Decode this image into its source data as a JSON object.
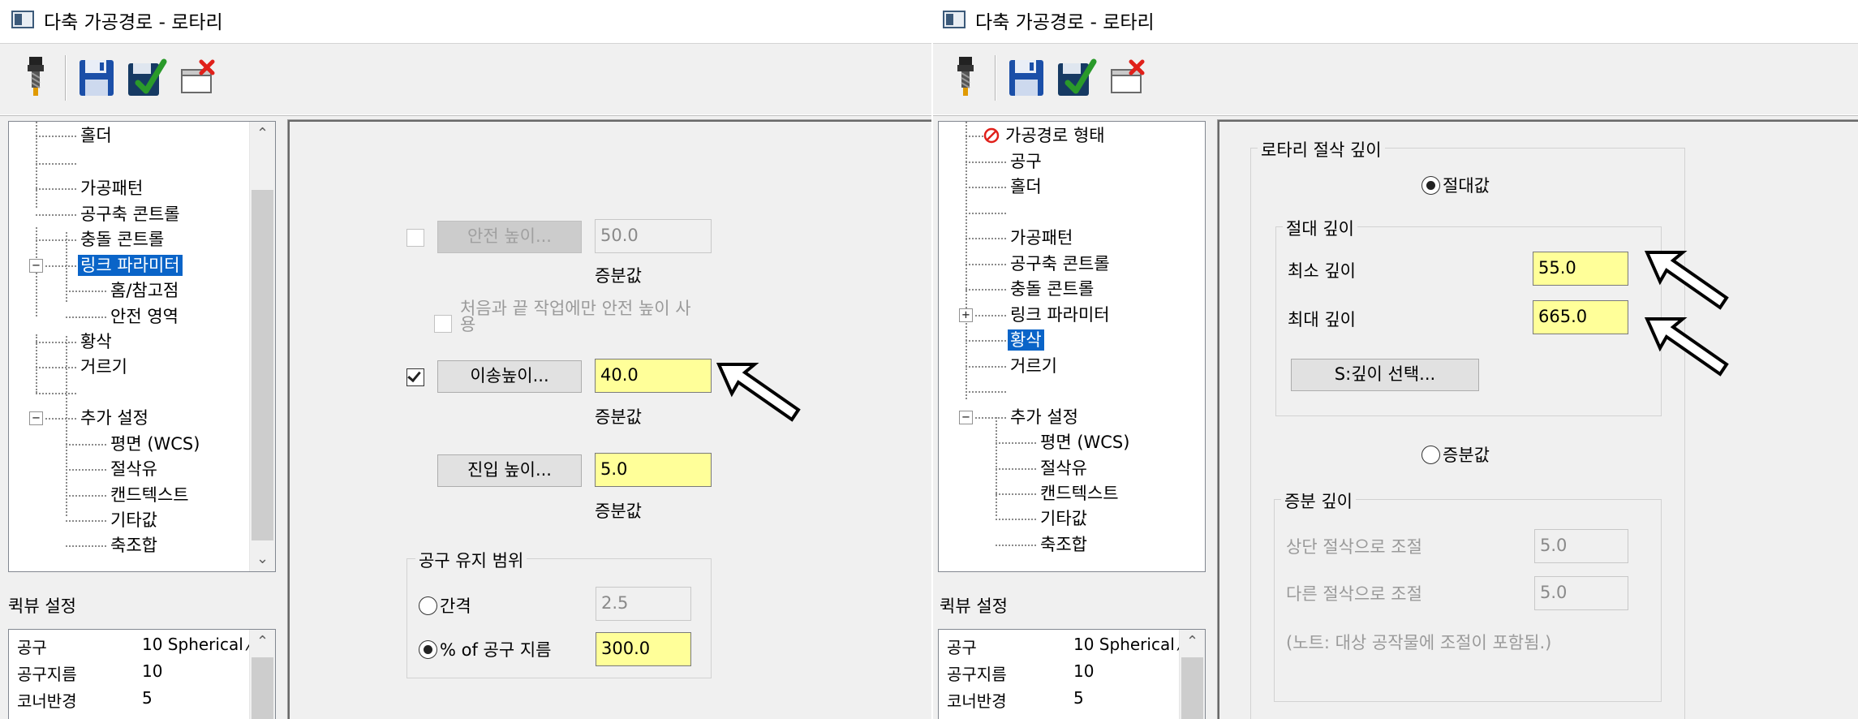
{
  "left": {
    "window": {
      "title": "다축 가공경로 - 로타리"
    },
    "tree": {
      "items": [
        {
          "label": "홀더"
        },
        {
          "label": "가공패턴"
        },
        {
          "label": "공구축 콘트롤"
        },
        {
          "label": "충돌 콘트롤"
        },
        {
          "label": "링크 파라미터",
          "selected": true
        },
        {
          "label": "홈/참고점"
        },
        {
          "label": "안전 영역"
        },
        {
          "label": "황삭"
        },
        {
          "label": "거르기"
        },
        {
          "label": "추가 설정"
        },
        {
          "label": "평면 (WCS)"
        },
        {
          "label": "절삭유"
        },
        {
          "label": "캔드텍스트"
        },
        {
          "label": "기타값"
        },
        {
          "label": "축조합"
        }
      ],
      "expander_minus": "−",
      "scroll_up": "⌃",
      "scroll_down": "⌄"
    },
    "quickview": {
      "label": "퀵뷰 설정",
      "rows": [
        {
          "key": "공구",
          "value": "10 Spherical ⁄"
        },
        {
          "key": "공구지름",
          "value": "10"
        },
        {
          "key": "코너반경",
          "value": "5"
        }
      ],
      "scroll_up": "⌃"
    },
    "form": {
      "safety": {
        "button": "안전 높이...",
        "value": "50.0",
        "mode": "증분값",
        "checked": false
      },
      "first_last_only": {
        "label": "처음과 끝 작업에만 안전 높이 사용",
        "checked": false
      },
      "retract": {
        "button": "이송높이...",
        "value": "40.0",
        "mode": "증분값",
        "checked": true
      },
      "plunge": {
        "button": "진입 높이...",
        "value": "5.0",
        "mode": "증분값"
      },
      "tool_containment": {
        "title": "공구 유지 범위",
        "gap": {
          "label": "간격",
          "value": "2.5",
          "selected": false
        },
        "percent": {
          "label": "% of 공구 지름",
          "value": "300.0",
          "selected": true
        }
      }
    }
  },
  "right": {
    "window": {
      "title": "다축 가공경로 - 로타리"
    },
    "tree": {
      "items": [
        {
          "label": "가공경로 형태",
          "error": true
        },
        {
          "label": "공구"
        },
        {
          "label": "홀더"
        },
        {
          "label": "가공패턴"
        },
        {
          "label": "공구축 콘트롤"
        },
        {
          "label": "충돌 콘트롤"
        },
        {
          "label": "링크 파라미터"
        },
        {
          "label": "황삭",
          "selected": true
        },
        {
          "label": "거르기"
        },
        {
          "label": "추가 설정"
        },
        {
          "label": "평면 (WCS)"
        },
        {
          "label": "절삭유"
        },
        {
          "label": "캔드텍스트"
        },
        {
          "label": "기타값"
        },
        {
          "label": "축조합"
        }
      ],
      "expander_plus": "+",
      "expander_minus": "−"
    },
    "quickview": {
      "label": "퀵뷰 설정",
      "rows": [
        {
          "key": "공구",
          "value": "10 Spherical ⁄"
        },
        {
          "key": "공구지름",
          "value": "10"
        },
        {
          "key": "코너반경",
          "value": "5"
        }
      ],
      "scroll_up": "⌃"
    },
    "form": {
      "rotary_depth": {
        "title": "로타리 절삭 깊이",
        "absolute": {
          "label": "절대값",
          "selected": true
        },
        "absolute_group": {
          "title": "절대 깊이",
          "min": {
            "label": "최소 깊이",
            "value": "55.0"
          },
          "max": {
            "label": "최대 깊이",
            "value": "665.0"
          },
          "select_button": "S:깊이 선택..."
        },
        "incremental": {
          "label": "증분값",
          "selected": false
        },
        "incremental_group": {
          "title": "증분 깊이",
          "top": {
            "label": "상단 절삭으로 조절",
            "value": "5.0"
          },
          "other": {
            "label": "다른 절삭으로 조절",
            "value": "5.0"
          },
          "note": "(노트: 대상 공작물에 조절이 포함됨.)"
        }
      }
    }
  },
  "icons": {
    "tool": "endmill-icon",
    "save": "save-icon",
    "save_apply": "save-apply-icon",
    "delete": "delete-icon",
    "error": "error-icon",
    "arrow": "pointer-arrow"
  },
  "colors": {
    "highlight_field": "#ffff99",
    "selected_item": "#0a64c8",
    "error_red": "#e0201a",
    "save_blue": "#1b4fa8",
    "save_green": "#2a9a2a"
  }
}
